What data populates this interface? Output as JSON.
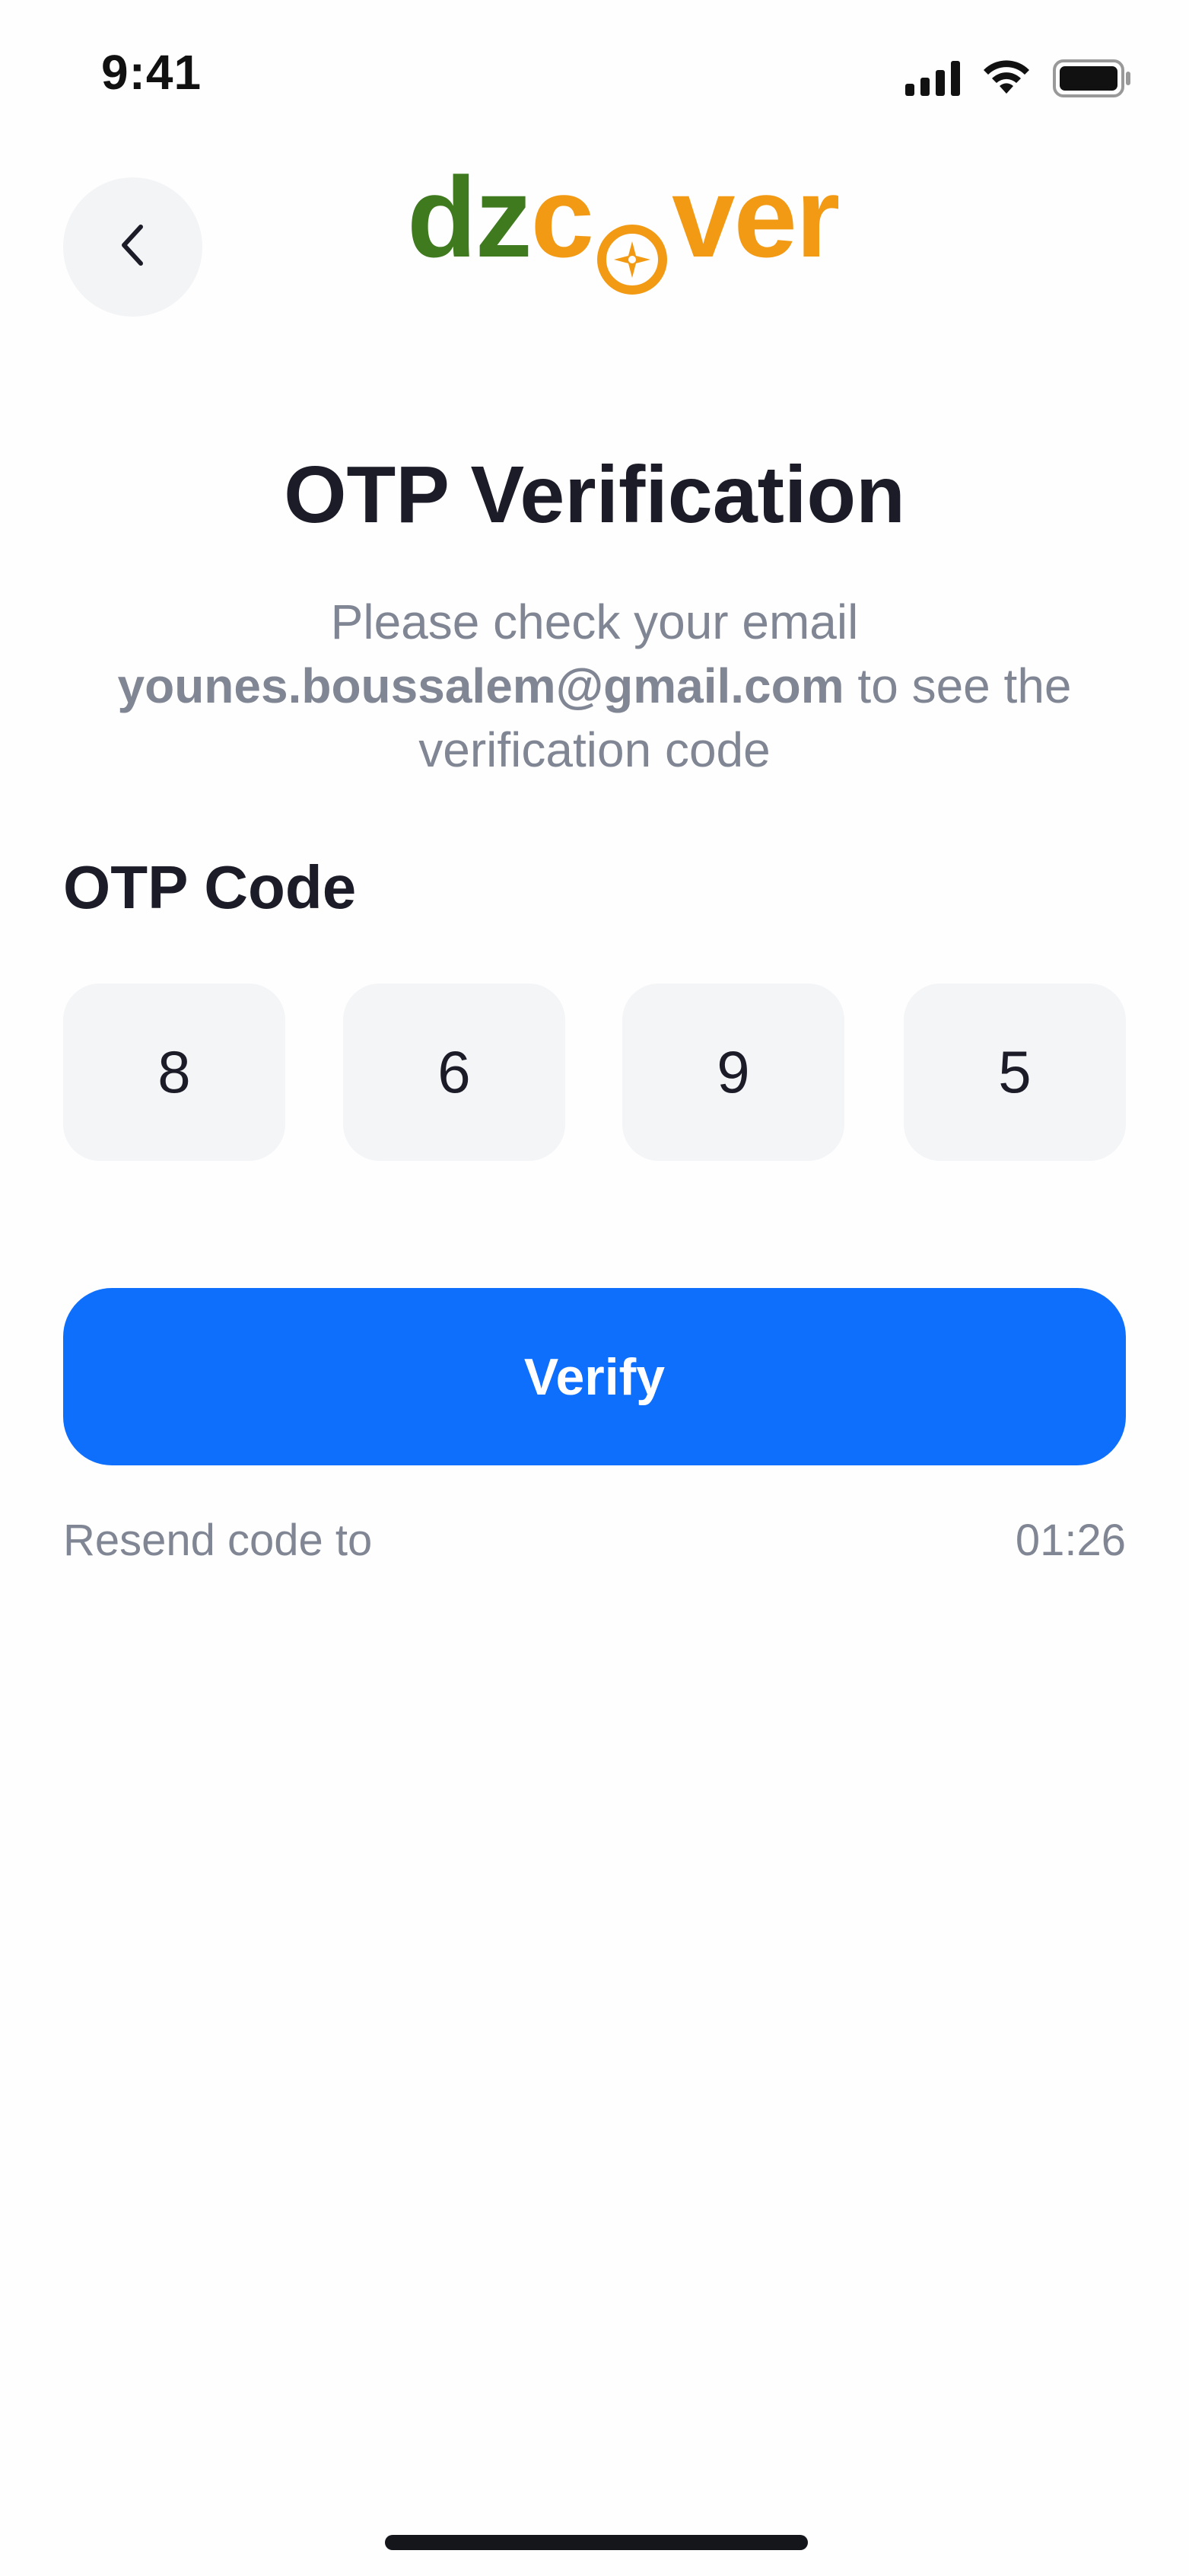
{
  "status_bar": {
    "time": "9:41",
    "icons": [
      "cellular-signal-icon",
      "wifi-icon",
      "battery-icon"
    ]
  },
  "header": {
    "back_icon": "chevron-left-icon",
    "logo": {
      "part1": "dz",
      "part2_prefix": "c",
      "compass_icon": "compass-icon",
      "part2_suffix": "ver"
    }
  },
  "title": "OTP Verification",
  "subtitle": {
    "line1": "Please check your email",
    "email": "younes.boussalem@gmail.com",
    "line2_suffix": " to see the",
    "line3": "verification code"
  },
  "otp": {
    "label": "OTP Code",
    "digits": [
      "8",
      "6",
      "9",
      "5"
    ]
  },
  "verify_button": {
    "label": "Verify"
  },
  "resend": {
    "label": "Resend code to",
    "timer": "01:26"
  },
  "colors": {
    "accent": "#0f6ffd",
    "logo_green": "#3f7a1e",
    "logo_orange": "#f29a14",
    "muted_text": "#818694",
    "input_bg": "#f4f5f7"
  }
}
